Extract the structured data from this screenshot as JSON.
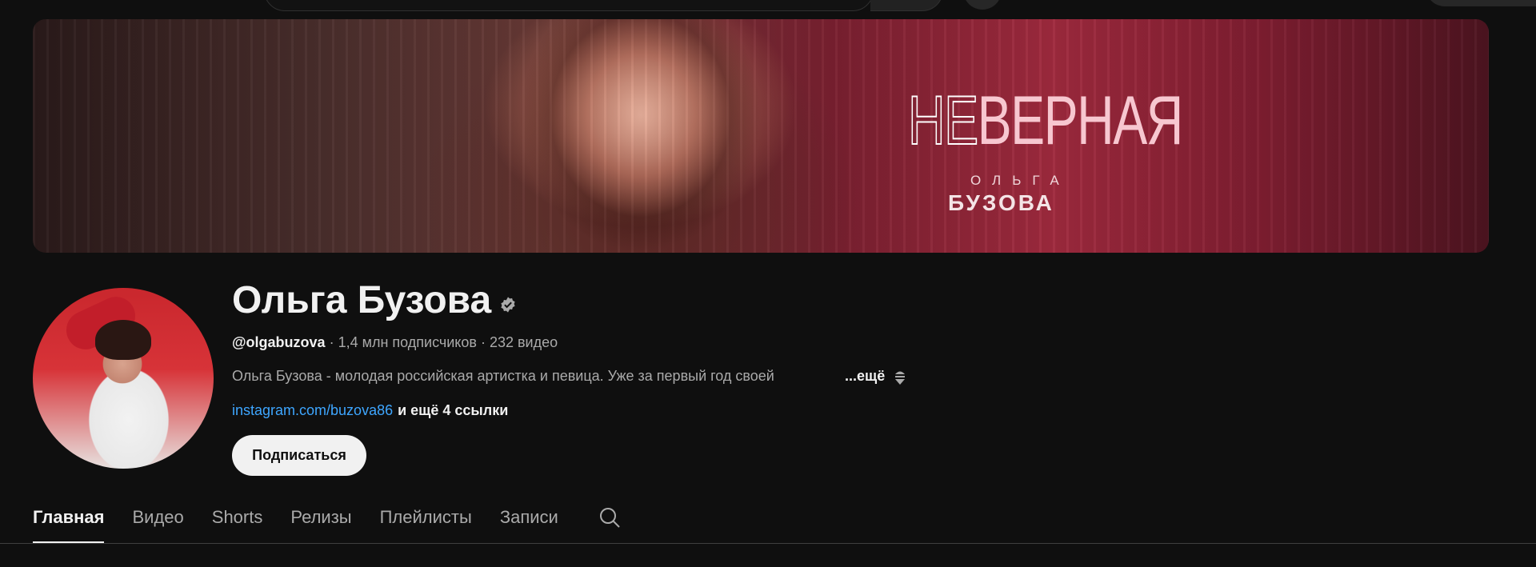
{
  "banner": {
    "title_ne": "НЕ",
    "title_rest": "ВЕРНАЯ",
    "artist_first": "ОЛЬГА",
    "artist_last": "БУЗОВА"
  },
  "channel": {
    "name": "Ольга Бузова",
    "handle": "@olgabuzova",
    "subscribers": "1,4 млн подписчиков",
    "videos": "232 видео",
    "separator": " · ",
    "description": "Ольга Бузова - молодая российская артистка и певица. Уже за первый год своей",
    "more_label": "...ещё",
    "link_text": "instagram.com/buzova86",
    "extra_links": "и ещё 4 ссылки",
    "subscribe_label": "Подписаться"
  },
  "tabs": [
    {
      "label": "Главная",
      "active": true
    },
    {
      "label": "Видео",
      "active": false
    },
    {
      "label": "Shorts",
      "active": false
    },
    {
      "label": "Релизы",
      "active": false
    },
    {
      "label": "Плейлисты",
      "active": false
    },
    {
      "label": "Записи",
      "active": false
    }
  ],
  "icons": {
    "verified": "verified-icon",
    "search": "search-icon",
    "expand": "expand-icon"
  },
  "colors": {
    "background": "#0f0f0f",
    "link": "#3ea6ff",
    "subscribe_bg": "#f1f1f1"
  }
}
